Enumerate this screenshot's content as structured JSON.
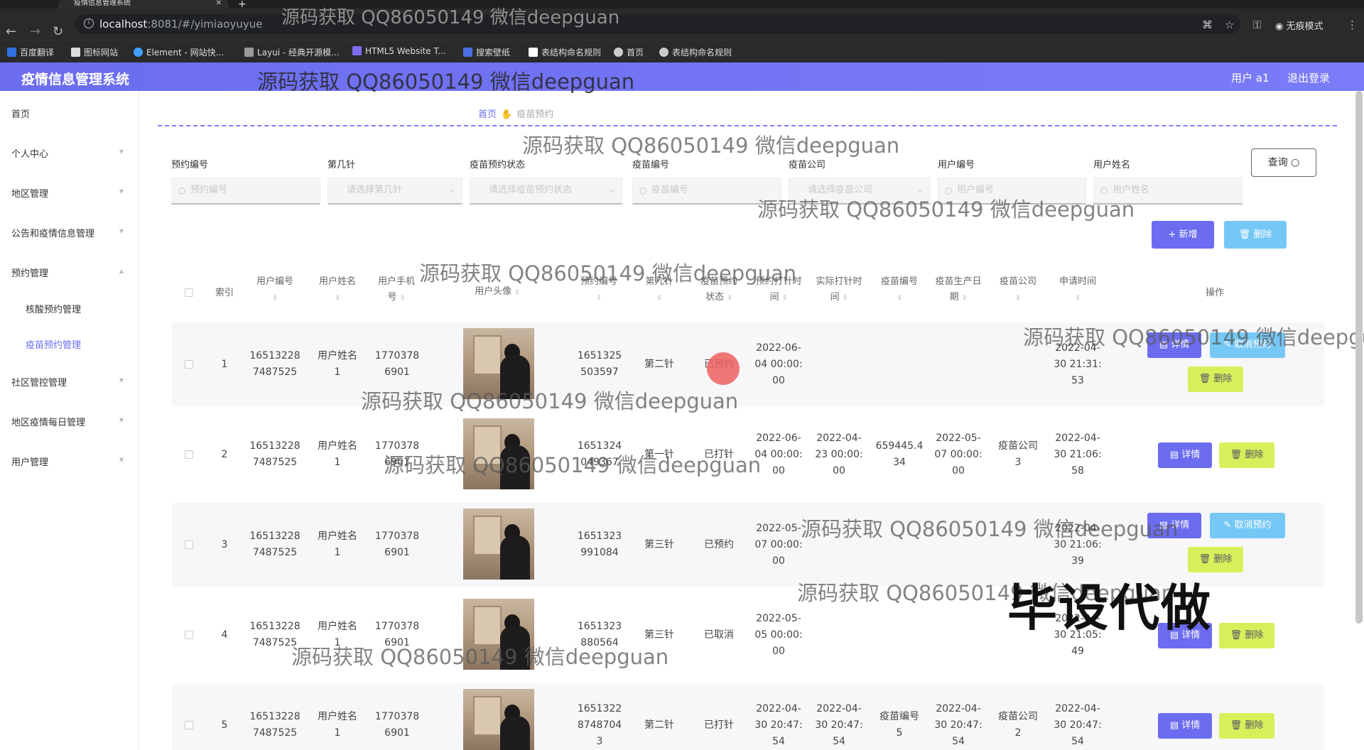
{
  "browser": {
    "tab_title": "疫情信息管理系统",
    "url_host": "localhost",
    "url_path": ":8081/#/yimiaoyuyue",
    "incognito_label": "无痕模式",
    "bookmarks": [
      "百度翻译",
      "图标网站",
      "Element - 网站快...",
      "Layui - 经典开源模...",
      "HTML5 Website T...",
      "搜索壁纸",
      "表结构命名规则",
      "首页",
      "表结构命名规则"
    ]
  },
  "header": {
    "title": "疫情信息管理系统",
    "user": "用户 a1",
    "logout": "退出登录"
  },
  "sidebar": {
    "items": [
      "首页",
      "个人中心",
      "地区管理",
      "公告和疫情信息管理",
      "预约管理",
      "核酸预约管理",
      "疫苗预约管理",
      "社区管控管理",
      "地区疫情每日管理",
      "用户管理"
    ]
  },
  "breadcrumb": {
    "home": "首页",
    "current": "疫苗预约"
  },
  "filters": {
    "labels": [
      "预约编号",
      "第几针",
      "疫苗预约状态",
      "疫苗编号",
      "疫苗公司",
      "用户编号",
      "用户姓名"
    ],
    "placeholders": [
      "预约编号",
      "请选择第几针",
      "请选择疫苗预约状态",
      "疫苗编号",
      "请选择疫苗公司",
      "用户编号",
      "用户姓名"
    ],
    "query_label": "查询",
    "add_label": "+ 新增",
    "delete_label": "删除"
  },
  "table": {
    "headers": [
      "索引",
      "用户编号",
      "用户姓名",
      "用户手机号",
      "用户头像",
      "预约编号",
      "第几针",
      "疫苗预约状态",
      "预约打针时间",
      "实际打针时间",
      "疫苗编号",
      "疫苗生产日期",
      "疫苗公司",
      "申请时间",
      "操作"
    ],
    "btn_detail": "详情",
    "btn_cancel": "取消预约",
    "btn_delete": "删除",
    "rows": [
      {
        "idx": "1",
        "uid": "16513228\n7487525",
        "uname": "用户姓名\n1",
        "phone": "1770378\n6901",
        "order": "1651325\n503597",
        "dose": "第二针",
        "status": "已预约",
        "appt": "2022-06-\n04 00:00:\n00",
        "actual": "",
        "vno": "",
        "vdate": "",
        "vco": "",
        "apply": "2022-04-\n30 21:31:\n53"
      },
      {
        "idx": "2",
        "uid": "16513228\n7487525",
        "uname": "用户姓名\n1",
        "phone": "1770378\n6901",
        "order": "1651324\n049367",
        "dose": "第一针",
        "status": "已打针",
        "appt": "2022-06-\n04 00:00:\n00",
        "actual": "2022-04-\n23 00:00:\n00",
        "vno": "659445.4\n34",
        "vdate": "2022-05-\n07 00:00:\n00",
        "vco": "疫苗公司\n3",
        "apply": "2022-04-\n30 21:06:\n58"
      },
      {
        "idx": "3",
        "uid": "16513228\n7487525",
        "uname": "用户姓名\n1",
        "phone": "1770378\n6901",
        "order": "1651323\n991084",
        "dose": "第三针",
        "status": "已预约",
        "appt": "2022-05-\n07 00:00:\n00",
        "actual": "",
        "vno": "",
        "vdate": "",
        "vco": "",
        "apply": "2022-04-\n30 21:06:\n39"
      },
      {
        "idx": "4",
        "uid": "16513228\n7487525",
        "uname": "用户姓名\n1",
        "phone": "1770378\n6901",
        "order": "1651323\n880564",
        "dose": "第三针",
        "status": "已取消",
        "appt": "2022-05-\n05 00:00:\n00",
        "actual": "",
        "vno": "",
        "vdate": "",
        "vco": "",
        "apply": "2022-04-\n30 21:05:\n49"
      },
      {
        "idx": "5",
        "uid": "16513228\n7487525",
        "uname": "用户姓名\n1",
        "phone": "1770378\n6901",
        "order": "1651322\n8748704\n3",
        "dose": "第二针",
        "status": "已打针",
        "appt": "2022-04-\n30 20:47:\n54",
        "actual": "2022-04-\n30 20:47:\n54",
        "vno": "疫苗编号\n5",
        "vdate": "2022-04-\n30 20:47:\n54",
        "vco": "疫苗公司\n2",
        "apply": "2022-04-\n30 20:47:\n54"
      }
    ]
  },
  "watermark": {
    "text": "源码获取 QQ86050149 微信deepguan",
    "big": "毕设代做"
  }
}
